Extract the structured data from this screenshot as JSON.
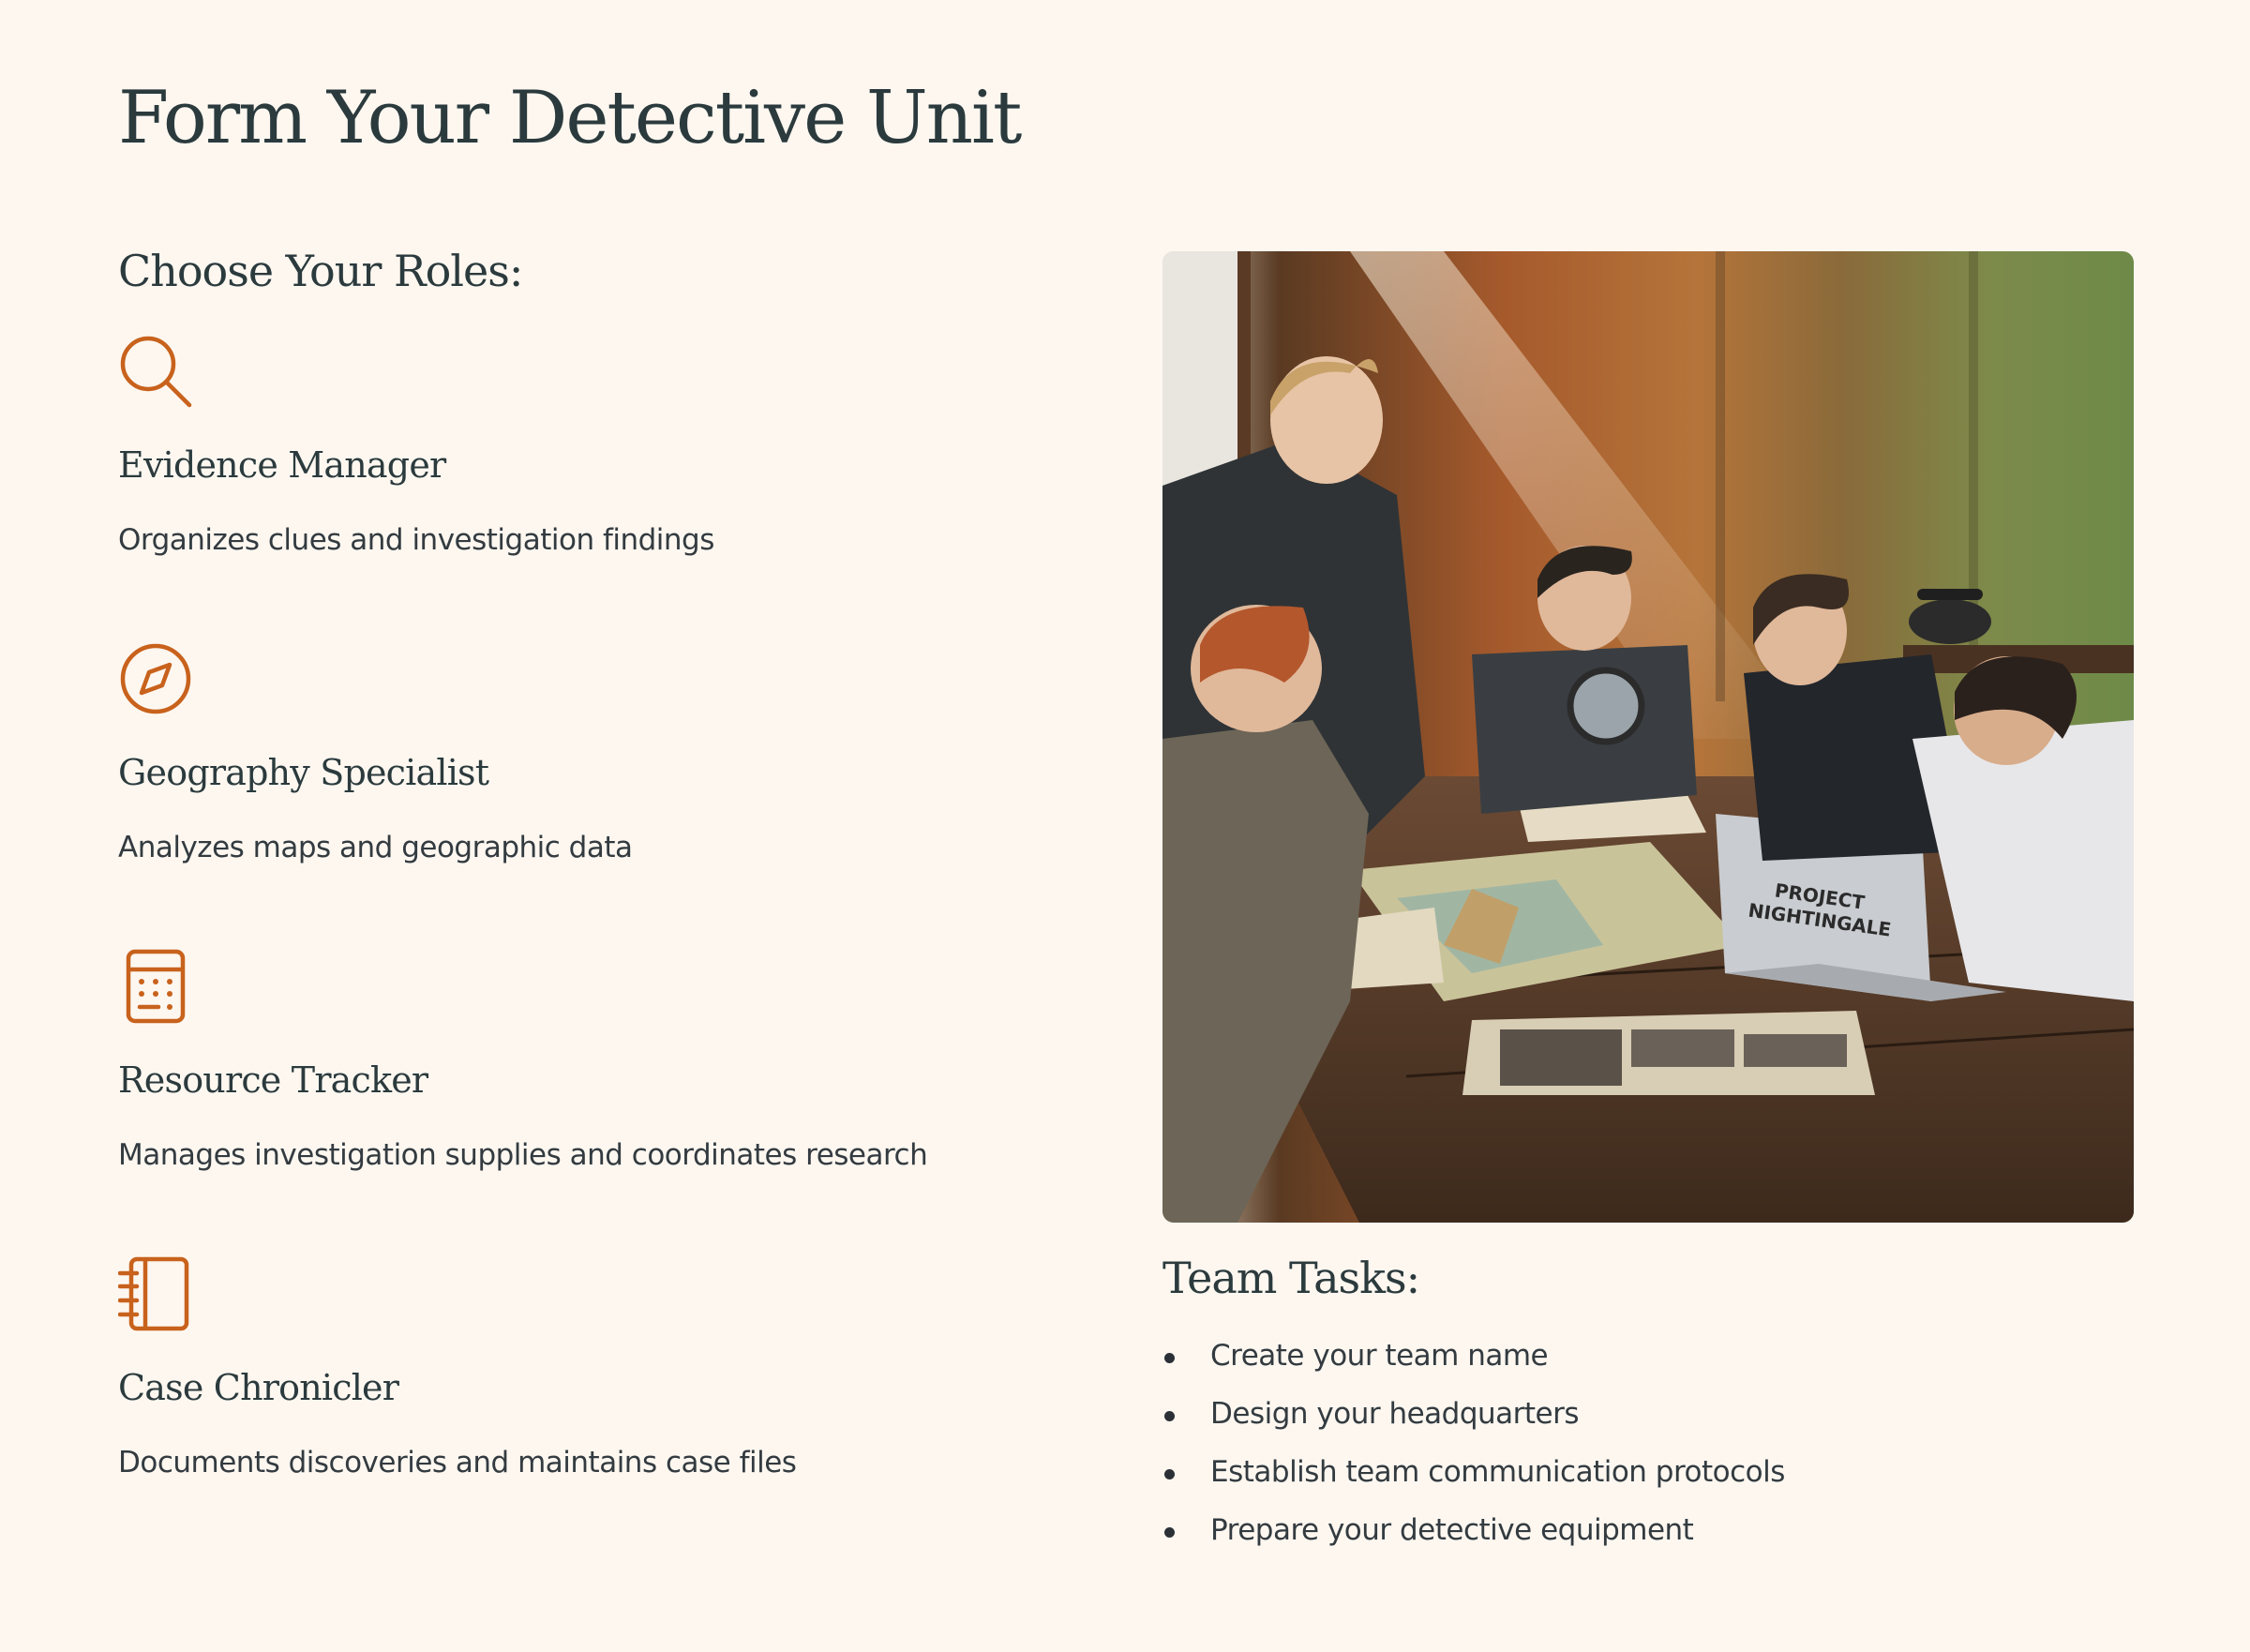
{
  "page_title": "Form Your Detective Unit",
  "roles_heading": "Choose Your Roles:",
  "roles": [
    {
      "icon": "magnifying-glass-icon",
      "title": "Evidence Manager",
      "description": "Organizes clues and investigation findings"
    },
    {
      "icon": "compass-icon",
      "title": "Geography Specialist",
      "description": "Analyzes maps and geographic data"
    },
    {
      "icon": "calculator-icon",
      "title": "Resource Tracker",
      "description": "Manages investigation supplies and coordinates research"
    },
    {
      "icon": "notebook-icon",
      "title": "Case Chronicler",
      "description": "Documents discoveries and maintains case files"
    }
  ],
  "photo": {
    "laptop_text_line1": "PROJECT",
    "laptop_text_line2": "NIGHTINGALE"
  },
  "tasks_heading": "Team Tasks:",
  "tasks": [
    "Create your team name",
    "Design your headquarters",
    "Establish team communication protocols",
    "Prepare your detective equipment"
  ],
  "colors": {
    "background": "#fdf7f0",
    "accent": "#c8621c",
    "heading": "#2b3a3d"
  }
}
